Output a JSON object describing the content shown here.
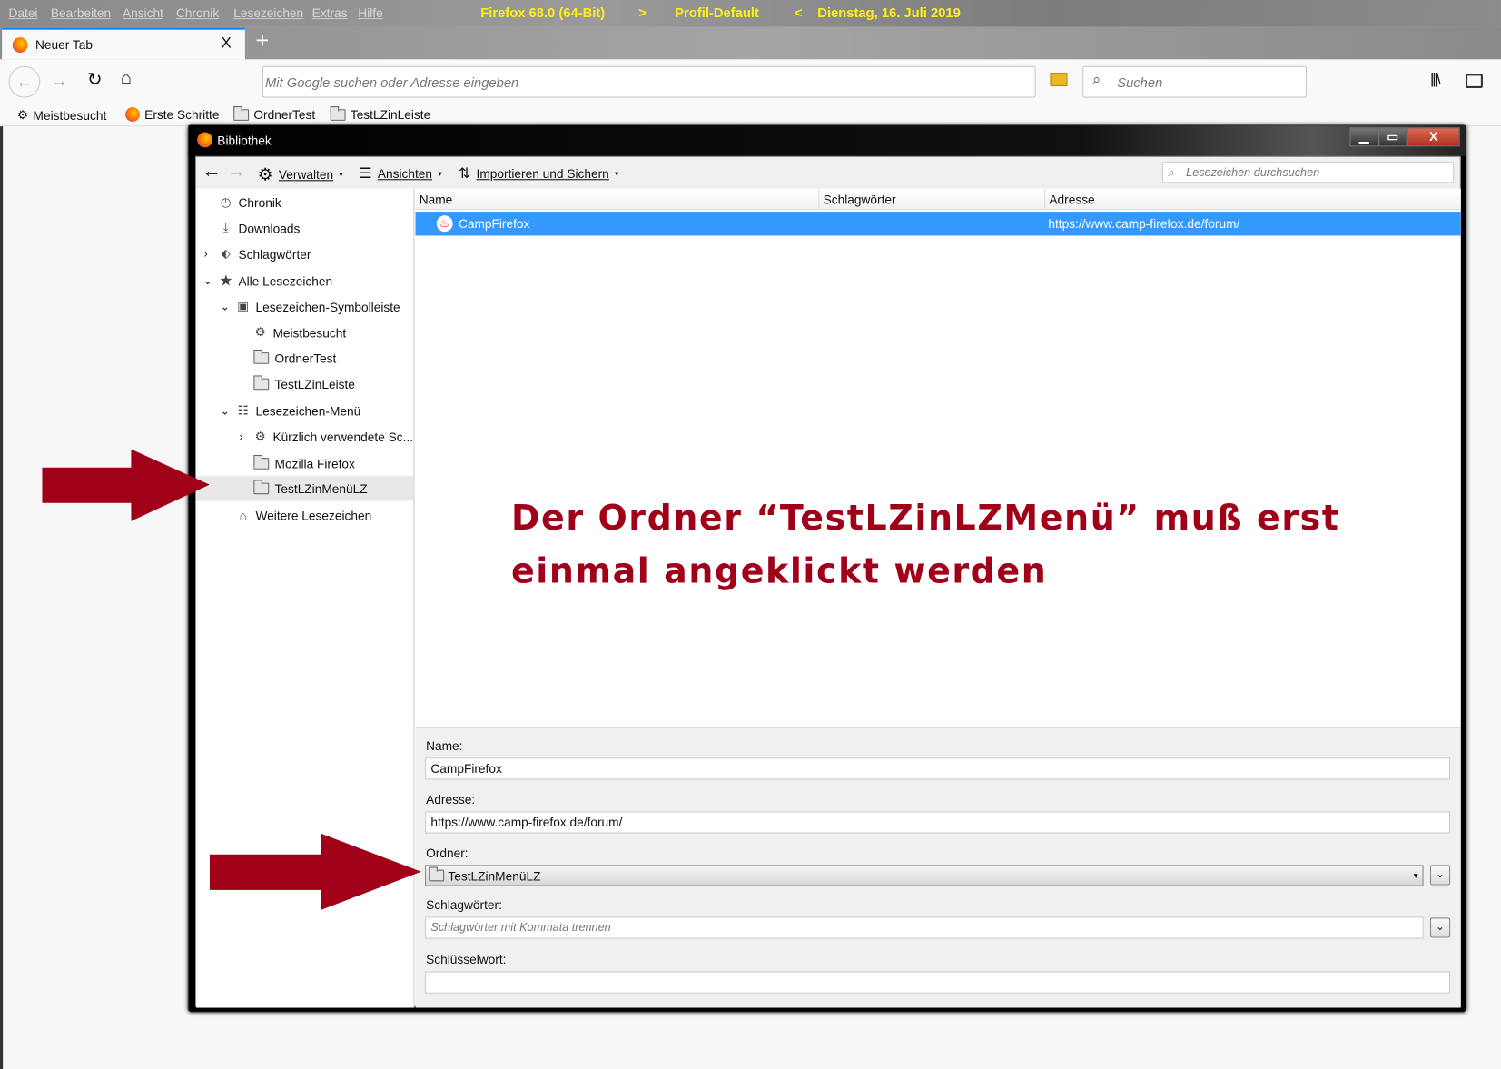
{
  "browser": {
    "menu": [
      "Datei",
      "Bearbeiten",
      "Ansicht",
      "Chronik",
      "Lesezeichen",
      "Extras",
      "Hilfe"
    ],
    "title_info": {
      "version": "Firefox 68.0 (64-Bit)",
      "sep1": ">",
      "profile": "Profil-Default",
      "sep2": "<",
      "date": "Dienstag, 16. Juli 2019"
    },
    "tab": {
      "label": "Neuer Tab",
      "close": "X",
      "new": "+"
    },
    "urlbar_placeholder": "Mit Google suchen oder Adresse eingeben",
    "search_placeholder": "Suchen",
    "bookmarks_toolbar": [
      "Meistbesucht",
      "Erste Schritte",
      "OrdnerTest",
      "TestLZinLeiste"
    ]
  },
  "library": {
    "title": "Bibliothek",
    "toolbar": {
      "manage": "Verwalten",
      "views": "Ansichten",
      "import": "Importieren und Sichern",
      "search_placeholder": "Lesezeichen durchsuchen"
    },
    "tree": [
      "Chronik",
      "Downloads",
      "Schlagwörter",
      "Alle Lesezeichen",
      "Lesezeichen-Symbolleiste",
      "Meistbesucht",
      "OrdnerTest",
      "TestLZinLeiste",
      "Lesezeichen-Menü",
      "Kürzlich verwendete Sc...",
      "Mozilla Firefox",
      "TestLZinMenüLZ",
      "Weitere Lesezeichen"
    ],
    "columns": [
      "Name",
      "Schlagwörter",
      "Adresse"
    ],
    "rows": [
      {
        "name": "CampFirefox",
        "tags": "",
        "address": "https://www.camp-firefox.de/forum/"
      }
    ],
    "details": {
      "name_label": "Name:",
      "name_value": "CampFirefox",
      "address_label": "Adresse:",
      "address_value": "https://www.camp-firefox.de/forum/",
      "folder_label": "Ordner:",
      "folder_value": "TestLZinMenüLZ",
      "tags_label": "Schlagwörter:",
      "tags_placeholder": "Schlagwörter mit Kommata trennen",
      "keyword_label": "Schlüsselwort:",
      "keyword_value": ""
    }
  },
  "annotation": {
    "line1": "Der Ordner “TestLZinLZMenü” muß erst",
    "line2": "einmal angeklickt werden",
    "color": "#a00018"
  }
}
